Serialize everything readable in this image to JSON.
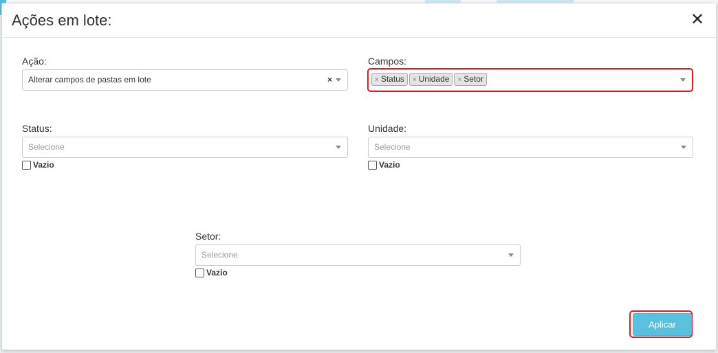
{
  "dialog": {
    "title": "Ações em lote:",
    "close_glyph": "✕"
  },
  "acao": {
    "label": "Ação:",
    "value": "Alterar campos de pastas em lote",
    "clear_glyph": "×"
  },
  "campos": {
    "label": "Campos:",
    "tags": [
      {
        "label": "Status",
        "remove_glyph": "×"
      },
      {
        "label": "Unidade",
        "remove_glyph": "×"
      },
      {
        "label": "Setor",
        "remove_glyph": "×"
      }
    ]
  },
  "status": {
    "label": "Status:",
    "placeholder": "Selecione",
    "empty_label": "Vazio"
  },
  "unidade": {
    "label": "Unidade:",
    "placeholder": "Selecione",
    "empty_label": "Vazio"
  },
  "setor": {
    "label": "Setor:",
    "placeholder": "Selecione",
    "empty_label": "Vazio"
  },
  "actions": {
    "apply_label": "Aplicar"
  },
  "colors": {
    "primary_button": "#5bc0de",
    "highlight_border": "#e31b23",
    "tag_background": "#e4e4e4"
  }
}
